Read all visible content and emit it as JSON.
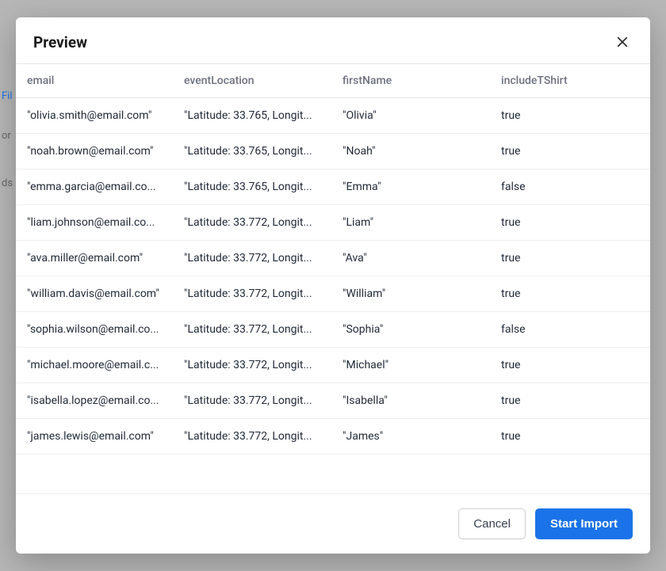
{
  "background": {
    "hint1": "Fil",
    "hint2": "or",
    "hint3": "ds"
  },
  "modal": {
    "title": "Preview",
    "columns": [
      "email",
      "eventLocation",
      "firstName",
      "includeTShirt"
    ],
    "rows": [
      {
        "email": "\"olivia.smith@email.com\"",
        "eventLocation": "\"Latitude: 33.765, Longit...",
        "firstName": "\"Olivia\"",
        "includeTShirt": "true"
      },
      {
        "email": "\"noah.brown@email.com\"",
        "eventLocation": "\"Latitude: 33.765, Longit...",
        "firstName": "\"Noah\"",
        "includeTShirt": "true"
      },
      {
        "email": "\"emma.garcia@email.co...",
        "eventLocation": "\"Latitude: 33.765, Longit...",
        "firstName": "\"Emma\"",
        "includeTShirt": "false"
      },
      {
        "email": "\"liam.johnson@email.co...",
        "eventLocation": "\"Latitude: 33.772, Longit...",
        "firstName": "\"Liam\"",
        "includeTShirt": "true"
      },
      {
        "email": "\"ava.miller@email.com\"",
        "eventLocation": "\"Latitude: 33.772, Longit...",
        "firstName": "\"Ava\"",
        "includeTShirt": "true"
      },
      {
        "email": "\"william.davis@email.com\"",
        "eventLocation": "\"Latitude: 33.772, Longit...",
        "firstName": "\"William\"",
        "includeTShirt": "true"
      },
      {
        "email": "\"sophia.wilson@email.co...",
        "eventLocation": "\"Latitude: 33.772, Longit...",
        "firstName": "\"Sophia\"",
        "includeTShirt": "false"
      },
      {
        "email": "\"michael.moore@email.c...",
        "eventLocation": "\"Latitude: 33.772, Longit...",
        "firstName": "\"Michael\"",
        "includeTShirt": "true"
      },
      {
        "email": "\"isabella.lopez@email.co...",
        "eventLocation": "\"Latitude: 33.772, Longit...",
        "firstName": "\"Isabella\"",
        "includeTShirt": "true"
      },
      {
        "email": "\"james.lewis@email.com\"",
        "eventLocation": "\"Latitude: 33.772, Longit...",
        "firstName": "\"James\"",
        "includeTShirt": "true"
      }
    ],
    "footer": {
      "cancel_label": "Cancel",
      "import_label": "Start Import"
    }
  }
}
